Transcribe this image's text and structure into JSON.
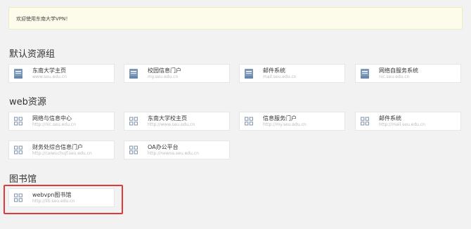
{
  "welcome_text": "欢迎使用东南大学VPN！",
  "groups": [
    {
      "title": "默认资源组",
      "items": [
        {
          "name": "东南大学主页",
          "url": "www.seu.edu.cn",
          "icon": "book-icon"
        },
        {
          "name": "校园信息门户",
          "url": "my.seu.edu.cn",
          "icon": "book-icon"
        },
        {
          "name": "邮件系统",
          "url": "mail.seu.edu.cn",
          "icon": "book-icon"
        },
        {
          "name": "网络自服务系统",
          "url": "nic.seu.edu.cn",
          "icon": "book-icon"
        }
      ]
    },
    {
      "title": "web资源",
      "items": [
        {
          "name": "网络与信息中心",
          "url": "http://nic.seu.edu.cn",
          "icon": "grid-icon"
        },
        {
          "name": "东南大学校主页",
          "url": "http://www.seu.edu.cn",
          "icon": "grid-icon"
        },
        {
          "name": "信息服务门户",
          "url": "http://my.seu.edu.cn",
          "icon": "grid-icon"
        },
        {
          "name": "邮件系统",
          "url": "http://mail.seu.edu.cn",
          "icon": "grid-icon"
        },
        {
          "name": "财务处综合信息门户",
          "url": "http://caiwuchujf.seu.edu.cn",
          "icon": "grid-icon"
        },
        {
          "name": "OA办公平台",
          "url": "http://newoa.seu.edu.cn",
          "icon": "grid-icon"
        }
      ]
    },
    {
      "title": "图书馆",
      "items": [
        {
          "name": "webvpn图书馆",
          "url": "http://lib.seu.edu.cn",
          "icon": "grid-icon"
        }
      ]
    }
  ],
  "colors": {
    "book_icon": "#7b97b7",
    "grid_icon": "#8a9bb0",
    "highlight": "#e0393a"
  }
}
